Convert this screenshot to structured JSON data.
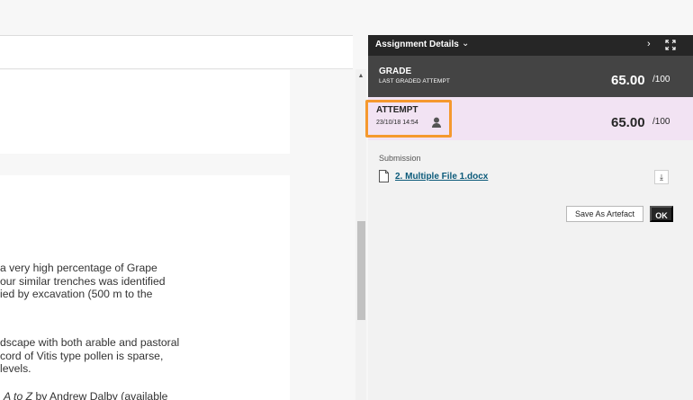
{
  "document": {
    "paragraph1": [
      "a very high percentage of Grape",
      "our similar trenches was identified",
      "ied by excavation (500 m to the"
    ],
    "paragraph2": [
      "dscape with both arable and pastoral",
      "cord of Vitis type pollen is sparse,",
      " levels."
    ],
    "paragraph3_italic": "A to Z",
    "paragraph3_rest": " by Andrew Dalby (available"
  },
  "panel": {
    "title": "Assignment Details",
    "grade": {
      "label": "GRADE",
      "sublabel": "LAST GRADED ATTEMPT",
      "score": "65.00",
      "max": "/100"
    },
    "attempt": {
      "label": "ATTEMPT",
      "date": "23/10/18 14:54",
      "score": "65.00",
      "max": "/100"
    },
    "submission": {
      "label": "Submission",
      "file_name": "2. Multiple File 1.docx"
    },
    "buttons": {
      "save_artefact": "Save As Artefact",
      "ok": "OK"
    }
  },
  "icons": {
    "details_chevron": "chevron-down-icon",
    "collapse": "chevron-right-icon",
    "expand": "expand-icon",
    "attempt_user": "user-icon",
    "file": "file-icon",
    "download": "download-icon"
  },
  "colors": {
    "panel_header": "#262626",
    "grade_bg": "#444444",
    "attempt_bg": "#f2e3f3",
    "highlight": "#f5992e",
    "link": "#0b5a7a"
  }
}
